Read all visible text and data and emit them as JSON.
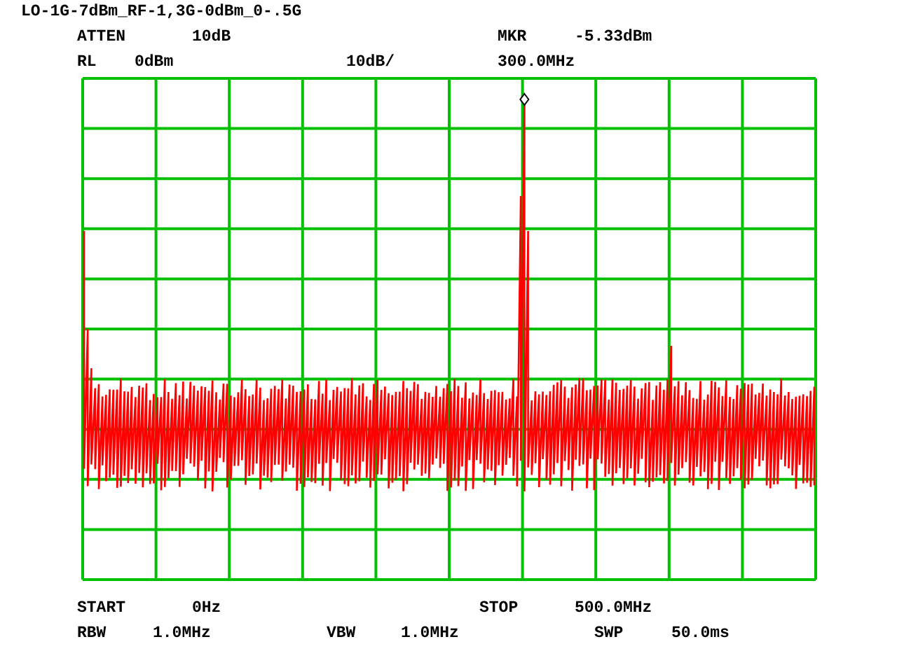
{
  "title": "LO-1G-7dBm_RF-1,3G-0dBm_0-.5G",
  "top_rows": [
    [
      "ATTEN",
      "10dB",
      "MKR",
      "-5.33dBm"
    ],
    [
      "RL",
      "0dBm",
      "10dB/",
      "300.0MHz"
    ]
  ],
  "bottom_rows": [
    [
      "START",
      "0Hz",
      "STOP",
      "500.0MHz"
    ],
    [
      "RBW",
      "1.0MHz",
      "VBW",
      "1.0MHz",
      "SWP",
      "50.0ms"
    ]
  ]
}
